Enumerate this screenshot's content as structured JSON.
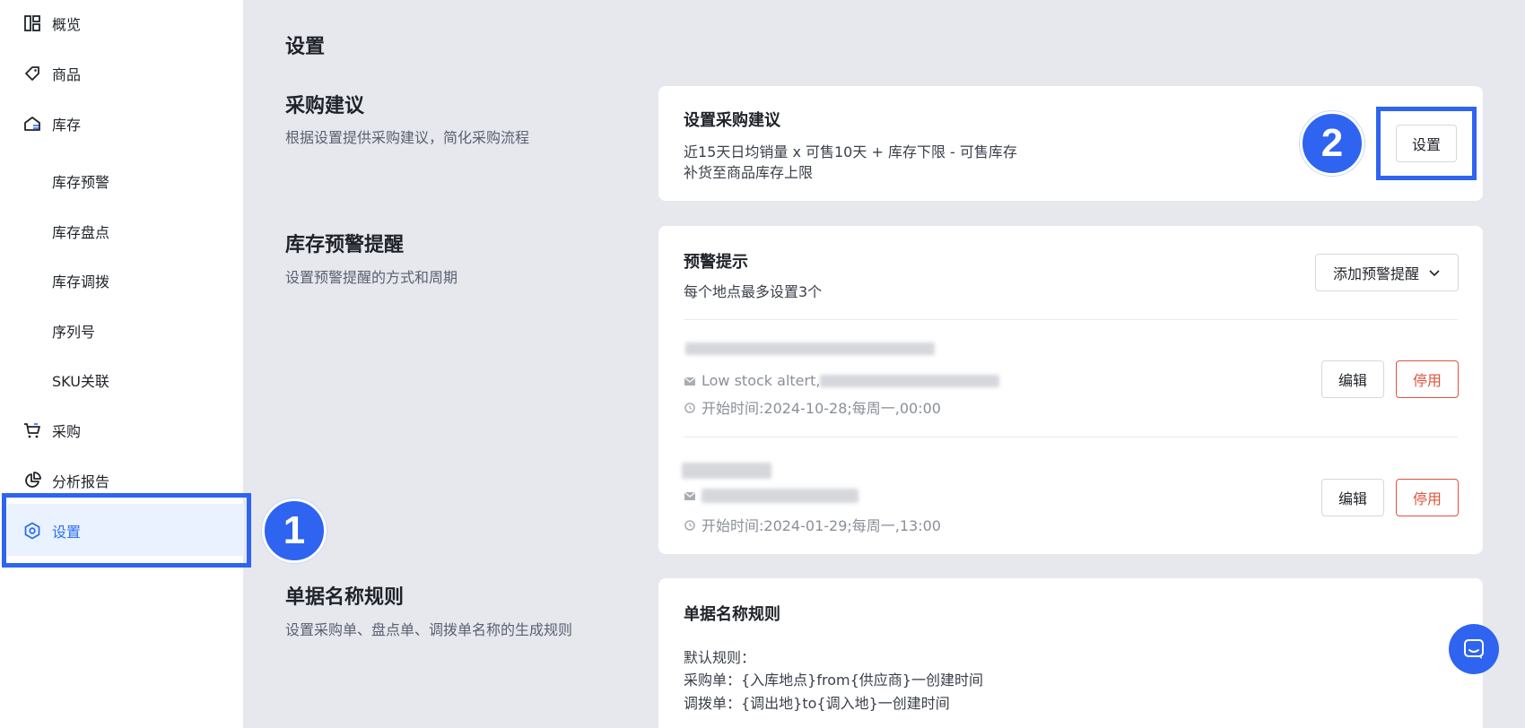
{
  "sidebar": {
    "items": [
      {
        "label": "概览",
        "icon": "dashboard-icon"
      },
      {
        "label": "商品",
        "icon": "tag-icon"
      },
      {
        "label": "库存",
        "icon": "warehouse-icon"
      },
      {
        "label": "库存预警"
      },
      {
        "label": "库存盘点"
      },
      {
        "label": "库存调拨"
      },
      {
        "label": "序列号"
      },
      {
        "label": "SKU关联"
      },
      {
        "label": "采购",
        "icon": "cart-icon"
      },
      {
        "label": "分析报告",
        "icon": "pie-chart-icon"
      },
      {
        "label": "设置",
        "icon": "settings-icon",
        "active": true
      }
    ]
  },
  "annotations": {
    "step1": "1",
    "step2": "2"
  },
  "main": {
    "page_title": "设置",
    "purchase": {
      "title": "采购建议",
      "desc": "根据设置提供采购建议，简化采购流程",
      "card_title": "设置采购建议",
      "line1": "近15天日均销量 x 可售10天 + 库存下限 - 可售库存",
      "line2": "补货至商品库存上限",
      "button": "设置"
    },
    "alert": {
      "title": "库存预警提醒",
      "desc": "设置预警提醒的方式和周期",
      "card_title": "预警提示",
      "card_desc": "每个地点最多设置3个",
      "add_button": "添加预警提醒",
      "rules": [
        {
          "email_text": "Low stock altert,",
          "start": "开始时间:2024-10-28;每周一,00:00",
          "edit": "编辑",
          "disable": "停用"
        },
        {
          "email_text": "",
          "start": "开始时间:2024-01-29;每周一,13:00",
          "edit": "编辑",
          "disable": "停用"
        }
      ]
    },
    "naming": {
      "title": "单据名称规则",
      "desc": "设置采购单、盘点单、调拨单名称的生成规则",
      "card_title": "单据名称规则",
      "default_label": "默认规则：",
      "purchase_rule": "采购单：{入库地点}from{供应商}一创建时间",
      "transfer_rule": "调拨单：{调出地}to{调入地}一创建时间"
    }
  },
  "colors": {
    "accent": "#2e64f0",
    "danger": "#e0533a",
    "background": "#e6e8ee"
  }
}
